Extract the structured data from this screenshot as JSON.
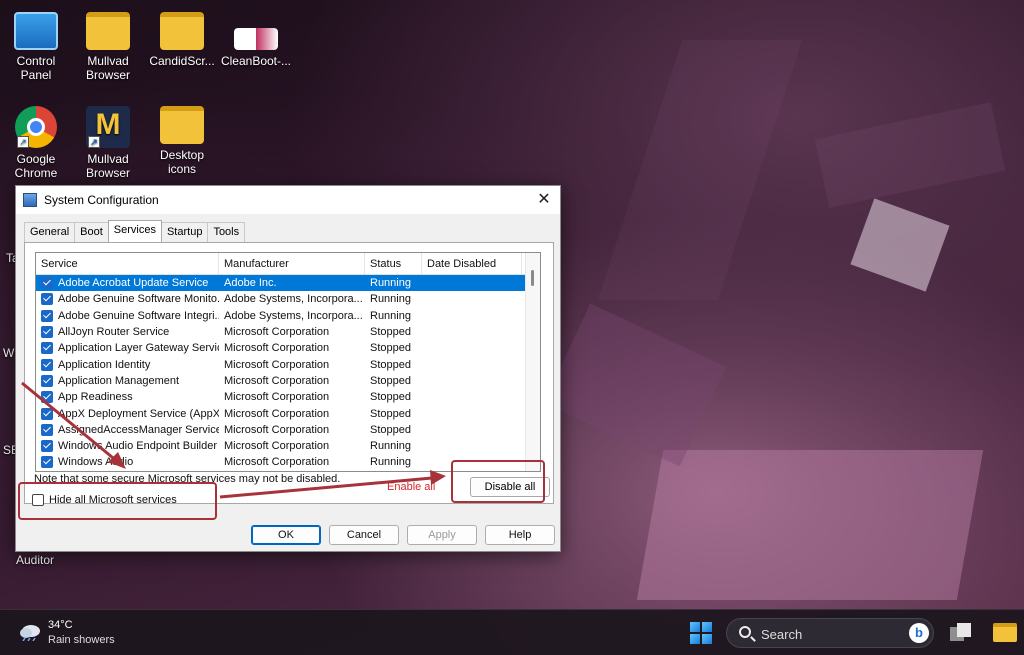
{
  "desktop": {
    "icons": [
      {
        "label": "Control Panel"
      },
      {
        "label": "Mullvad\nBrowser"
      },
      {
        "label": "CandidScr..."
      },
      {
        "label": "CleanBoot-..."
      },
      {
        "label": "Google\nChrome"
      },
      {
        "label": "Mullvad\nBrowser"
      },
      {
        "label": "Desktop\nicons"
      }
    ],
    "left_labels": [
      "Ta",
      "W",
      "SE",
      "Auditor"
    ]
  },
  "dialog": {
    "title": "System Configuration",
    "close": "✕",
    "tabs": [
      "General",
      "Boot",
      "Services",
      "Startup",
      "Tools"
    ],
    "active_tab": "Services",
    "columns": [
      "Service",
      "Manufacturer",
      "Status",
      "Date Disabled"
    ],
    "rows": [
      {
        "service": "Adobe Acrobat Update Service",
        "manufacturer": "Adobe Inc.",
        "status": "Running",
        "date": "",
        "checked": true,
        "selected": true
      },
      {
        "service": "Adobe Genuine Software Monito...",
        "manufacturer": "Adobe Systems, Incorpora...",
        "status": "Running",
        "date": "",
        "checked": true
      },
      {
        "service": "Adobe Genuine Software Integri...",
        "manufacturer": "Adobe Systems, Incorpora...",
        "status": "Running",
        "date": "",
        "checked": true
      },
      {
        "service": "AllJoyn Router Service",
        "manufacturer": "Microsoft Corporation",
        "status": "Stopped",
        "date": "",
        "checked": true
      },
      {
        "service": "Application Layer Gateway Service",
        "manufacturer": "Microsoft Corporation",
        "status": "Stopped",
        "date": "",
        "checked": true
      },
      {
        "service": "Application Identity",
        "manufacturer": "Microsoft Corporation",
        "status": "Stopped",
        "date": "",
        "checked": true
      },
      {
        "service": "Application Management",
        "manufacturer": "Microsoft Corporation",
        "status": "Stopped",
        "date": "",
        "checked": true
      },
      {
        "service": "App Readiness",
        "manufacturer": "Microsoft Corporation",
        "status": "Stopped",
        "date": "",
        "checked": true
      },
      {
        "service": "AppX Deployment Service (AppX...",
        "manufacturer": "Microsoft Corporation",
        "status": "Stopped",
        "date": "",
        "checked": true
      },
      {
        "service": "AssignedAccessManager Service",
        "manufacturer": "Microsoft Corporation",
        "status": "Stopped",
        "date": "",
        "checked": true
      },
      {
        "service": "Windows Audio Endpoint Builder",
        "manufacturer": "Microsoft Corporation",
        "status": "Running",
        "date": "",
        "checked": true
      },
      {
        "service": "Windows Audio",
        "manufacturer": "Microsoft Corporation",
        "status": "Running",
        "date": "",
        "checked": true
      }
    ],
    "note": "Note that some secure Microsoft services may not be disabled.",
    "enable_all": "Enable all",
    "disable_all": "Disable all",
    "hide_ms_label": "Hide all Microsoft services",
    "hide_ms_checked": false,
    "buttons": {
      "ok": "OK",
      "cancel": "Cancel",
      "apply": "Apply",
      "help": "Help"
    }
  },
  "taskbar": {
    "temperature": "34°C",
    "condition": "Rain showers",
    "search_label": "Search",
    "bing": "b"
  },
  "colors": {
    "highlight": "#a8323a",
    "selection": "#0078d7",
    "accent": "#1a68c7"
  }
}
